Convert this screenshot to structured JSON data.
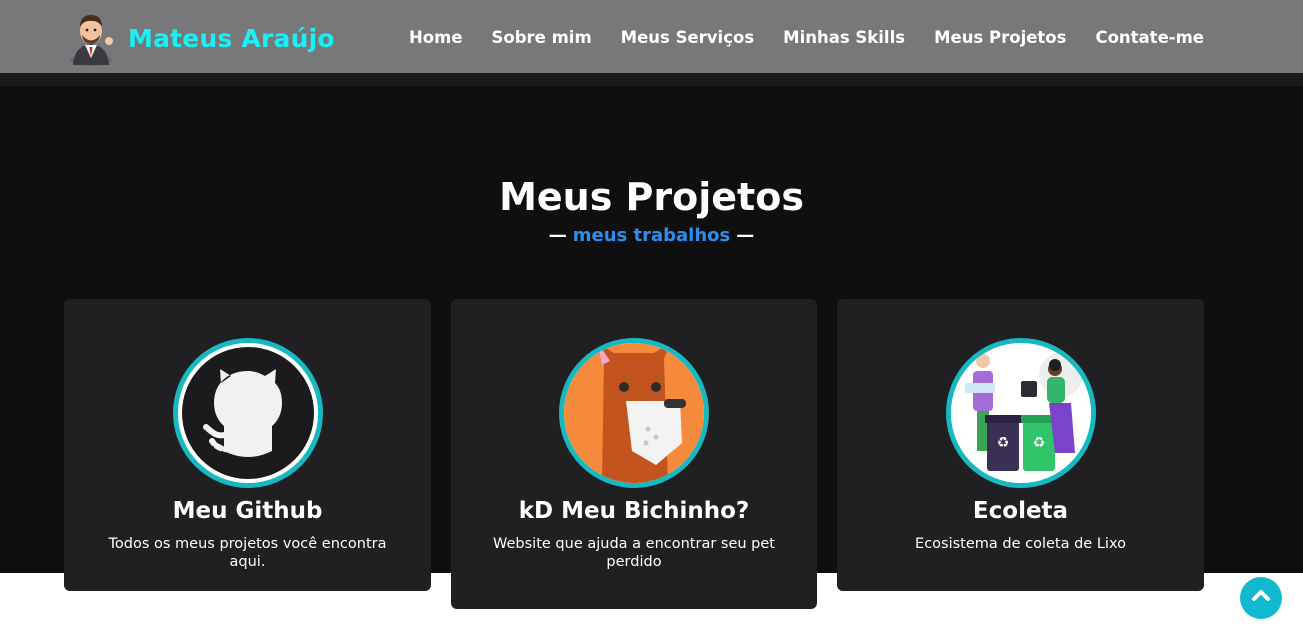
{
  "brand": {
    "name": "Mateus Araújo",
    "avatar_icon": "businessman-avatar-icon"
  },
  "nav": {
    "items": [
      {
        "label": "Home"
      },
      {
        "label": "Sobre mim"
      },
      {
        "label": "Meus Serviços"
      },
      {
        "label": "Minhas Skills"
      },
      {
        "label": "Meus Projetos"
      },
      {
        "label": "Contate-me"
      }
    ]
  },
  "section": {
    "title": "Meus Projetos",
    "subtitle": "meus trabalhos",
    "subtitle_dash": "—"
  },
  "projects": [
    {
      "title": "Meu Github",
      "description": "Todos os meus projetos você encontra aqui.",
      "icon": "github-octocat-icon"
    },
    {
      "title": "kD Meu Bichinho?",
      "description": "Website que ajuda a encontrar seu pet perdido",
      "icon": "dog-face-icon"
    },
    {
      "title": "Ecoleta",
      "description": "Ecosistema de coleta de Lixo",
      "icon": "recycling-people-icon"
    }
  ],
  "scroll_top": {
    "icon": "chevron-up-icon"
  },
  "colors": {
    "navbar_bg": "#78787a",
    "brand_accent": "#18f0f5",
    "section_bg": "#0f0f10",
    "card_bg": "#202022",
    "image_ring": "#15b9bf",
    "subtitle_accent": "#2d8ef0",
    "scroll_button": "#10b9d0"
  }
}
